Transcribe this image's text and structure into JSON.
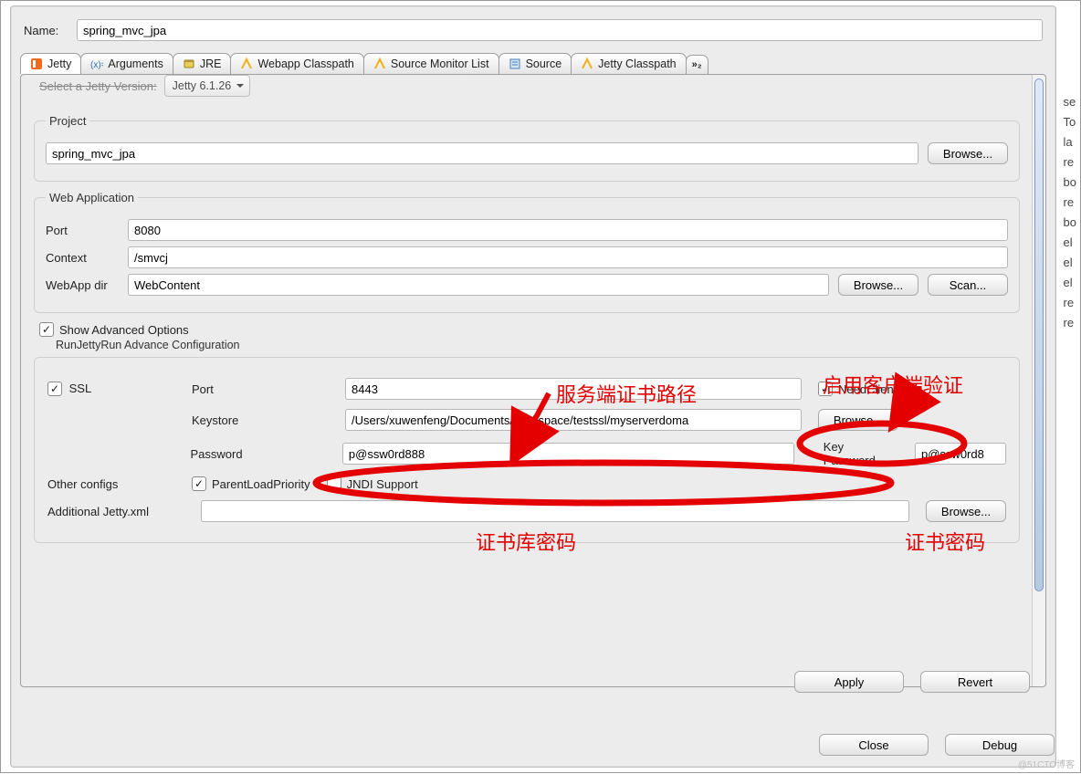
{
  "name_label": "Name:",
  "name_value": "spring_mvc_jpa",
  "tabs": {
    "jetty": "Jetty",
    "arguments": "Arguments",
    "jre": "JRE",
    "webapp": "Webapp Classpath",
    "smon": "Source Monitor List",
    "source": "Source",
    "jettycp": "Jetty Classpath",
    "more": "»₂"
  },
  "top": {
    "jetty_version_label": "Select a Jetty Version:",
    "jetty_version_value": "Jetty 6.1.26"
  },
  "project": {
    "legend": "Project",
    "value": "spring_mvc_jpa",
    "browse": "Browse..."
  },
  "webapp": {
    "legend": "Web Application",
    "port_label": "Port",
    "port_value": "8080",
    "context_label": "Context",
    "context_value": "/smvcj",
    "webappdir_label": "WebApp dir",
    "webappdir_value": "WebContent",
    "browse": "Browse...",
    "scan": "Scan..."
  },
  "adv_toggle": "Show Advanced Options",
  "adv_title": "RunJettyRun Advance Configuration",
  "adv": {
    "ssl_label": "SSL",
    "ssl_port_label": "Port",
    "ssl_port_value": "8443",
    "need_client_auth": "NeedClientAuth",
    "keystore_label": "Keystore",
    "keystore_value": "/Users/xuwenfeng/Documents/workspace/testssl/myserverdoma",
    "keystore_browse": "Browse...",
    "password_label": "Password",
    "password_value": "p@ssw0rd888",
    "keypassword_label": "Key Password",
    "keypassword_value": "p@ssw0rd8",
    "other_label": "Other configs",
    "parent_load": "ParentLoadPriority",
    "jndi": "JNDI Support",
    "addxml_label": "Additional Jetty.xml",
    "addxml_browse": "Browse..."
  },
  "buttons": {
    "apply": "Apply",
    "revert": "Revert",
    "close": "Close",
    "debug": "Debug"
  },
  "annotations": {
    "server_cert_path": "服务端证书路径",
    "enable_client_auth": "启用客户端验证",
    "keystore_pwd": "证书库密码",
    "cert_pwd": "证书密码"
  },
  "peek": [
    "se",
    "To",
    "la",
    "re",
    "bo",
    "re",
    "bo",
    "el",
    "el",
    "el",
    "re",
    "re"
  ],
  "watermark": "@51CTO博客"
}
